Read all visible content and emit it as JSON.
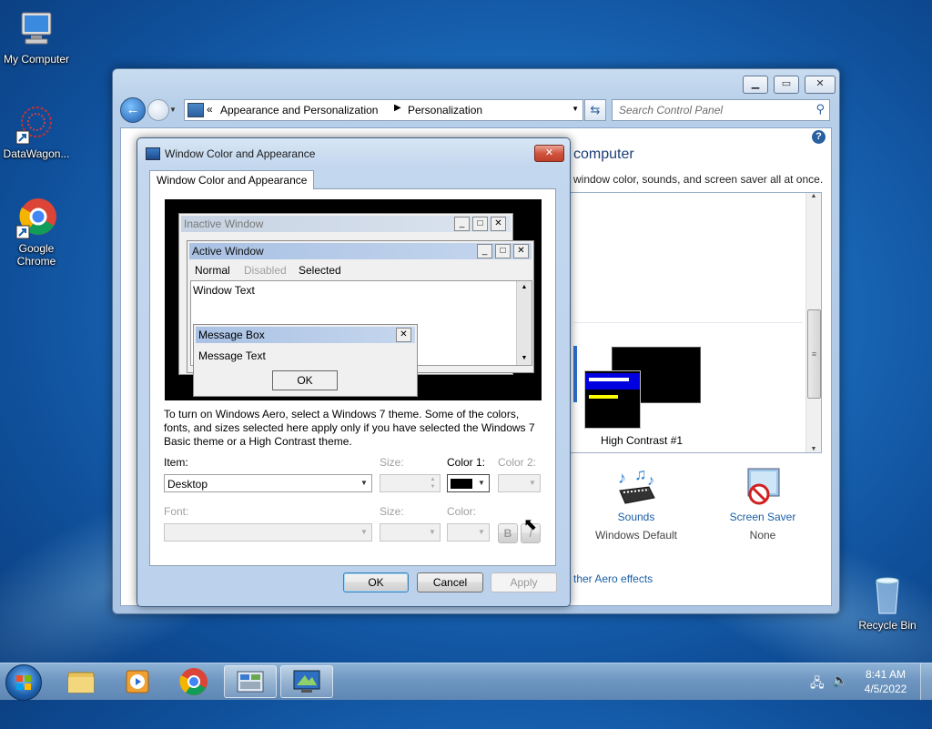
{
  "desktop": {
    "icons": [
      {
        "label": "My Computer"
      },
      {
        "label": "DataWagon..."
      },
      {
        "label": "Google Chrome"
      },
      {
        "label": "Recycle Bin"
      }
    ]
  },
  "control_panel": {
    "breadcrumb": {
      "root": "Appearance and Personalization",
      "current": "Personalization"
    },
    "search_placeholder": "Search Control Panel",
    "heading_fragment": "computer",
    "subtitle_fragment": "window color, sounds, and screen saver all at once.",
    "theme_name": "High Contrast #1",
    "sounds_label": "Sounds",
    "sounds_value": "Windows Default",
    "saver_label": "Screen Saver",
    "saver_value": "None",
    "aero_link": "ther Aero effects"
  },
  "dialog": {
    "title": "Window Color and Appearance",
    "tab": "Window Color and Appearance",
    "preview": {
      "inactive_title": "Inactive Window",
      "active_title": "Active Window",
      "menu_normal": "Normal",
      "menu_disabled": "Disabled",
      "menu_selected": "Selected",
      "window_text": "Window Text",
      "msgbox_title": "Message Box",
      "msgbox_text": "Message Text",
      "msgbox_ok": "OK"
    },
    "info_text": "To turn on Windows Aero, select a Windows 7 theme.  Some of the colors, fonts, and sizes selected here apply only if you have selected the Windows 7 Basic theme or a High Contrast theme.",
    "item_label": "Item:",
    "item_value": "Desktop",
    "size_label": "Size:",
    "color1_label": "Color 1:",
    "color2_label": "Color 2:",
    "color1_value": "#000000",
    "font_label": "Font:",
    "font_size_label": "Size:",
    "font_color_label": "Color:",
    "bold_label": "B",
    "italic_label": "I",
    "ok": "OK",
    "cancel": "Cancel",
    "apply": "Apply"
  },
  "taskbar": {
    "time": "8:41 AM",
    "date": "4/5/2022"
  },
  "colors": {
    "accent": "#1e5aa8",
    "link": "#1a5ea6",
    "preview_selected": "#3b6fd8"
  }
}
